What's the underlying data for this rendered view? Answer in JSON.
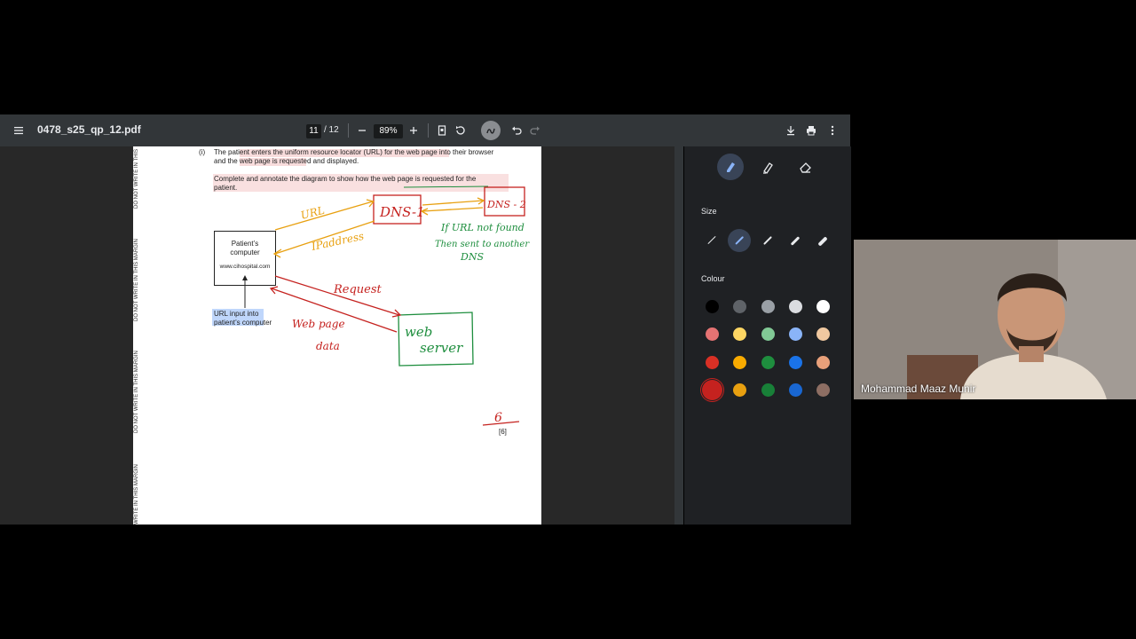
{
  "toolbar": {
    "filename": "0478_s25_qp_12.pdf",
    "current_page": "11",
    "total_pages": "/ 12",
    "zoom": "89%"
  },
  "page": {
    "margin_labels": [
      "DO NOT WRITE IN THIS",
      "DO NOT WRITE IN THIS MARGIN",
      "DO NOT WRITE IN THIS MARGIN",
      "WRITE IN THIS MARGIN"
    ],
    "question_number": "(i)",
    "question_line1": "The patient enters the uniform resource locator (URL) for the web page into their browser",
    "question_line2": "and the web page is requested and displayed.",
    "instruction_line1": "Complete and annotate the diagram to show how the web page is requested for the",
    "instruction_line2": "patient.",
    "box_title_line1": "Patient’s",
    "box_title_line2": "computer",
    "box_url": "www.cihospital.com",
    "caption_line1": "URL input into",
    "caption_line2": "patient’s computer",
    "marks": "[6]",
    "score": "6"
  },
  "annotations": {
    "dns1": "DNS-1",
    "dns2": "DNS - 2",
    "url": "URL",
    "ip": "IPaddress",
    "note1": "If URL not found",
    "note2": "Then sent to another",
    "note3": "DNS",
    "request": "Request",
    "webpage1": "Web page",
    "webpage2": "data",
    "server1": "web",
    "server2": "server"
  },
  "sidebar": {
    "size_label": "Size",
    "colour_label": "Colour",
    "colours": [
      "#000000",
      "#5f6368",
      "#9aa0a6",
      "#dadce0",
      "#ffffff",
      "#e57373",
      "#fdd663",
      "#81c995",
      "#8ab4f8",
      "#f0c8a0",
      "#d93025",
      "#f9ab00",
      "#1e8e3e",
      "#1a73e8",
      "#e8a07a",
      "#c5221f",
      "#e8a010",
      "#188038",
      "#1967d2",
      "#8d6e63"
    ],
    "selected_colour": "#c5221f"
  },
  "video": {
    "participant_name": "Mohammad Maaz Munir"
  },
  "icons": [
    "menu-icon",
    "minus-icon",
    "plus-icon",
    "fit-page-icon",
    "rotate-icon",
    "annotate-icon",
    "undo-icon",
    "redo-icon",
    "download-icon",
    "print-icon",
    "more-icon",
    "pen-icon",
    "highlighter-icon",
    "eraser-icon"
  ]
}
